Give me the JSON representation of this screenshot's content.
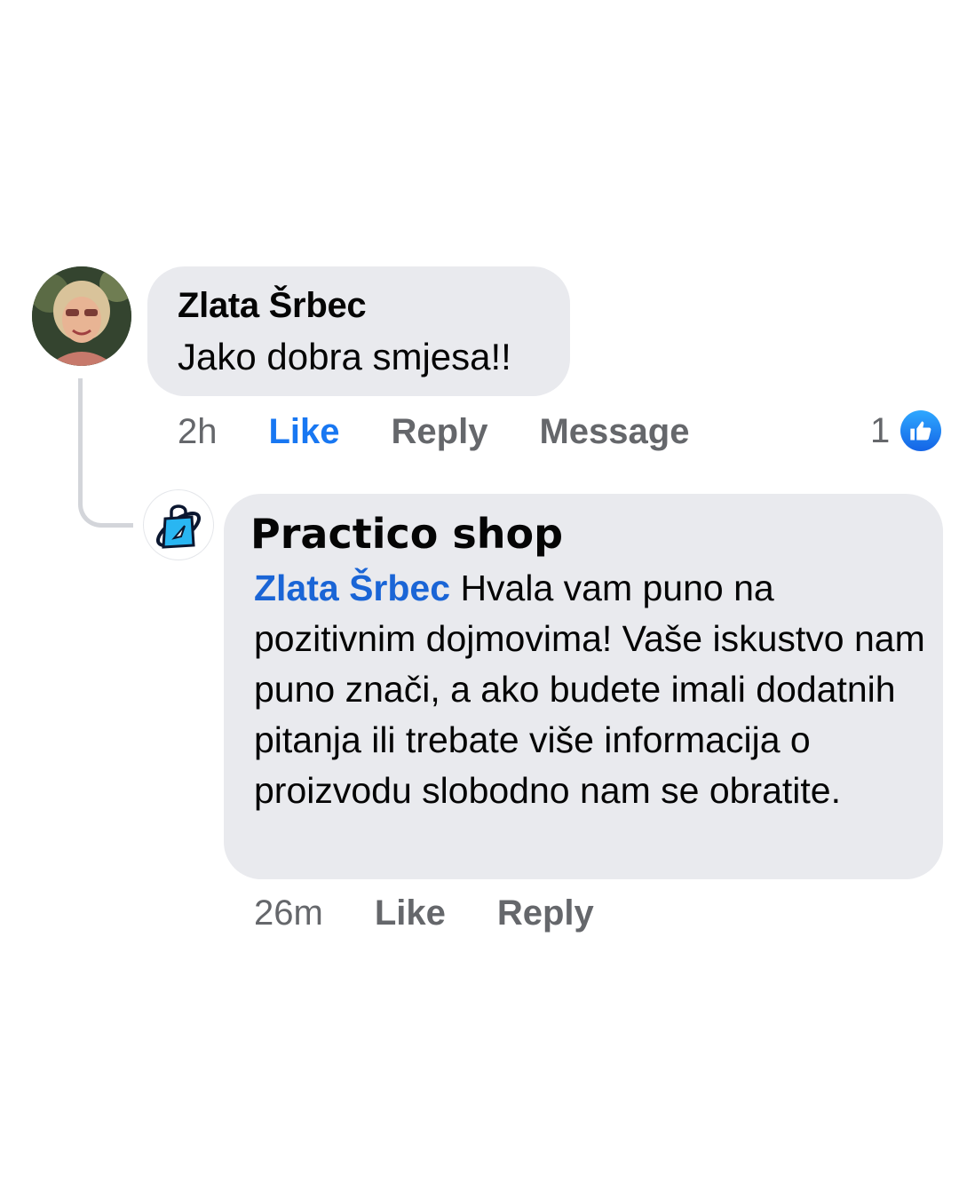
{
  "comments": [
    {
      "author": "Zlata Šrbec",
      "text": "Jako dobra smjesa!!",
      "time": "2h",
      "actions": {
        "like": "Like",
        "reply": "Reply",
        "message": "Message"
      },
      "like_state": "liked",
      "reaction_count": "1"
    }
  ],
  "reply": {
    "author": "Practico shop",
    "mention": "Zlata Šrbec",
    "text": " Hvala vam puno na pozitivnim  dojmovima! Vaše iskustvo nam puno znači, a ako budete imali dodatnih pitanja ili trebate više informacija o proizvodu slobodno nam se obratite.",
    "time": "26m",
    "actions": {
      "like": "Like",
      "reply": "Reply"
    }
  },
  "icons": {
    "user_avatar": "avatar-photo",
    "shop_avatar": "shopping-bag-icon",
    "reaction": "thumbs-up-icon"
  },
  "colors": {
    "bubble": "#e9eaee",
    "link_blue": "#1877f2",
    "secondary_text": "#65676b"
  }
}
